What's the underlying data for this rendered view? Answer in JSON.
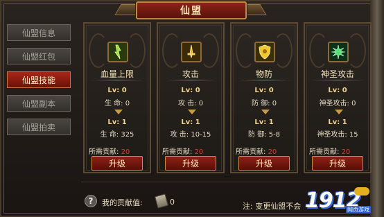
{
  "window": {
    "title": "仙盟"
  },
  "sidebar": {
    "items": [
      {
        "label": "仙盟信息",
        "active": false
      },
      {
        "label": "仙盟红包",
        "active": false
      },
      {
        "label": "仙盟技能",
        "active": true
      },
      {
        "label": "仙盟副本",
        "active": false
      },
      {
        "label": "仙盟拍卖",
        "active": false
      }
    ]
  },
  "skills": [
    {
      "name": "血量上限",
      "icon": "health-skill-icon",
      "icon_color": "#7ac030",
      "current_level": "Lv: 0",
      "current_stat_label": "生  命:",
      "current_stat_value": "0",
      "next_level": "Lv: 1",
      "next_stat_label": "生  命:",
      "next_stat_value": "325",
      "required_label": "所需贡献:",
      "required_value": "20",
      "button": "升级"
    },
    {
      "name": "攻击",
      "icon": "attack-skill-icon",
      "icon_color": "#e0a020",
      "current_level": "Lv: 0",
      "current_stat_label": "攻  击:",
      "current_stat_value": "0",
      "next_level": "Lv: 1",
      "next_stat_label": "攻  击:",
      "next_stat_value": "10-15",
      "required_label": "所需贡献:",
      "required_value": "20",
      "button": "升级"
    },
    {
      "name": "物防",
      "icon": "defense-skill-icon",
      "icon_color": "#e8c030",
      "current_level": "Lv: 0",
      "current_stat_label": "防  御:",
      "current_stat_value": "0",
      "next_level": "Lv: 1",
      "next_stat_label": "防  御:",
      "next_stat_value": "5-8",
      "required_label": "所需贡献:",
      "required_value": "20",
      "button": "升级"
    },
    {
      "name": "神圣攻击",
      "icon": "holy-attack-skill-icon",
      "icon_color": "#40c060",
      "current_level": "Lv: 0",
      "current_stat_label": "神圣攻击:",
      "current_stat_value": "0",
      "next_level": "Lv: 1",
      "next_stat_label": "神圣攻击:",
      "next_stat_value": "15",
      "required_label": "所需贡献:",
      "required_value": "20",
      "button": "升级"
    }
  ],
  "footer": {
    "my_contribution_label": "我的贡献值:",
    "my_contribution_value": "0",
    "note": "注: 变更仙盟不会"
  },
  "watermark": {
    "number": "1912",
    "badge": "yx",
    "sub": "网页游戏"
  },
  "colors": {
    "accent_red": "#8e2014",
    "gold": "#c89a48",
    "required_red": "#e23a2a"
  }
}
